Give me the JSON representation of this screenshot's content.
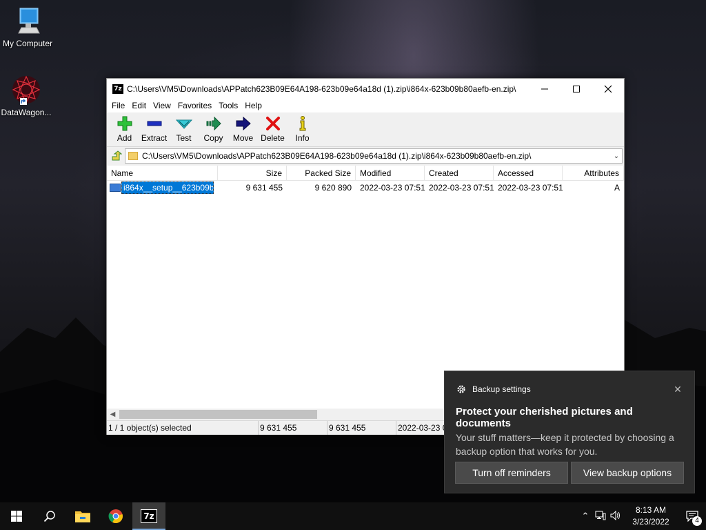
{
  "desktop": {
    "icons": [
      {
        "label": "My Computer",
        "icon": "computer-icon"
      },
      {
        "label": "DataWagon...",
        "icon": "datawagon-shortcut-icon"
      }
    ]
  },
  "window": {
    "app_icon_text": "7z",
    "title": "C:\\Users\\VM5\\Downloads\\APPatch623B09E64A198-623b09e64a18d (1).zip\\i864x-623b09b80aefb-en.zip\\",
    "menu": [
      "File",
      "Edit",
      "View",
      "Favorites",
      "Tools",
      "Help"
    ],
    "toolbar": {
      "add": "Add",
      "extract": "Extract",
      "test": "Test",
      "copy": "Copy",
      "move": "Move",
      "delete": "Delete",
      "info": "Info"
    },
    "address": "C:\\Users\\VM5\\Downloads\\APPatch623B09E64A198-623b09e64a18d (1).zip\\i864x-623b09b80aefb-en.zip\\",
    "columns": [
      "Name",
      "Size",
      "Packed Size",
      "Modified",
      "Created",
      "Accessed",
      "Attributes"
    ],
    "rows": [
      {
        "name": "i864x__setup__623b09b7...",
        "size": "9 631 455",
        "packed": "9 620 890",
        "modified": "2022-03-23 07:51",
        "created": "2022-03-23 07:51",
        "accessed": "2022-03-23 07:51",
        "attributes": "A"
      }
    ],
    "status": {
      "selected": "1 / 1 object(s) selected",
      "size": "9 631 455",
      "packed": "9 631 455",
      "date": "2022-03-23 07:51"
    }
  },
  "toast": {
    "app": "Backup settings",
    "title": "Protect your cherished pictures and documents",
    "body": "Your stuff matters—keep it protected by choosing a backup option that works for you.",
    "button_1": "Turn off reminders",
    "button_2": "View backup options"
  },
  "taskbar": {
    "pinned": [
      "start-icon",
      "search-icon",
      "file-explorer-icon",
      "chrome-icon",
      "7zip-icon"
    ],
    "time": "8:13 AM",
    "date": "3/23/2022",
    "notification_count": "4"
  },
  "colors": {
    "selection": "#0078d7",
    "toast_bg": "#2b2b2b",
    "taskbar": "#101010"
  }
}
